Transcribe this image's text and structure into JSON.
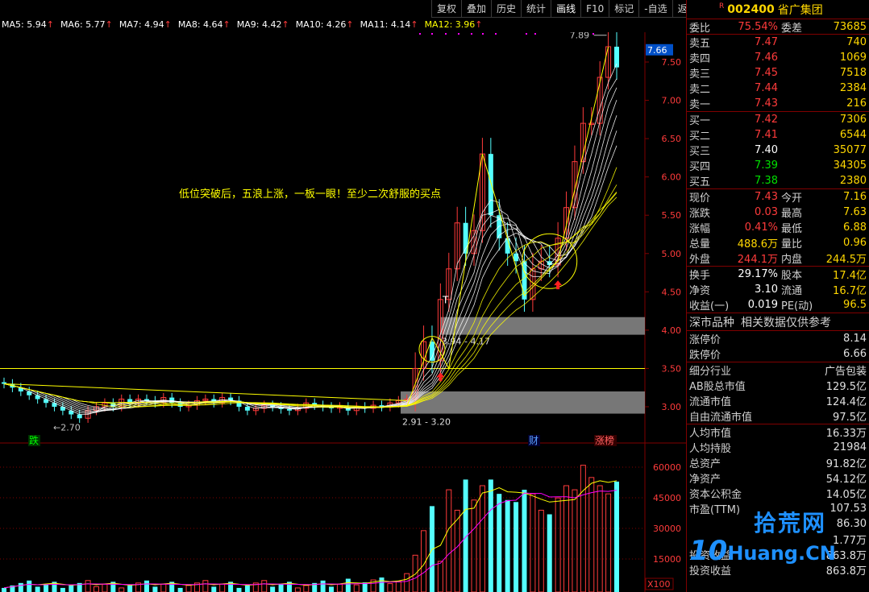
{
  "toolbar": [
    "复权",
    "叠加",
    "历史",
    "统计",
    "画线",
    "F10",
    "标记",
    "-自选",
    "返回"
  ],
  "toolbar_active": "画线",
  "ma_legend": [
    {
      "label": "MA5: 5.94",
      "color": "#ffffff"
    },
    {
      "label": "MA6: 5.77",
      "color": "#ffffff"
    },
    {
      "label": "MA7: 4.94",
      "color": "#ffffff"
    },
    {
      "label": "MA8: 4.64",
      "color": "#ffffff"
    },
    {
      "label": "MA9: 4.42",
      "color": "#ffffff"
    },
    {
      "label": "MA10: 4.26",
      "color": "#ffffff"
    },
    {
      "label": "MA11: 4.14",
      "color": "#ffffff"
    },
    {
      "label": "MA12: 3.96",
      "color": "#ffff00"
    }
  ],
  "ma_arrow": "↑",
  "chart": {
    "annotation": "低位突破后，五浪上涨，一板一眼！至少二次舒服的买点",
    "peak_label": "7.89",
    "current_price_label": "7.66",
    "low_label": "2.70",
    "zone_upper_label": "3.94 - 4.17",
    "zone_lower_label": "2.91 - 3.20",
    "t_marker": "T",
    "event_fall": "跌",
    "event_finance": "财",
    "event_list": "涨榜",
    "vol_unit": "X100",
    "price_ticks": [
      "7.50",
      "7.00",
      "6.50",
      "6.00",
      "5.50",
      "5.00",
      "4.50",
      "4.00",
      "3.50",
      "3.00"
    ],
    "vol_ticks": [
      "60000",
      "45000",
      "30000",
      "15000"
    ]
  },
  "chart_data": {
    "type": "candlestick",
    "price_axis": {
      "min": 2.6,
      "max": 8.0
    },
    "candles_early_note": "",
    "closes": [
      3.3,
      3.25,
      3.2,
      3.15,
      3.1,
      3.05,
      3.0,
      2.95,
      2.9,
      2.85,
      2.95,
      3.0,
      3.05,
      3.0,
      3.1,
      3.05,
      3.1,
      3.08,
      3.05,
      3.12,
      3.05,
      3.0,
      3.02,
      3.08,
      3.1,
      3.05,
      3.12,
      3.08,
      3.0,
      2.95,
      2.98,
      3.02,
      3.0,
      2.97,
      2.95,
      2.98,
      3.05,
      3.02,
      3.0,
      2.98,
      3.0,
      2.95,
      3.0,
      2.98,
      3.02,
      3.0,
      3.05,
      3.08,
      3.1,
      3.5,
      3.85,
      3.6,
      4.4,
      4.8,
      5.4,
      5.0,
      5.3,
      6.3,
      5.5,
      5.2,
      5.0,
      4.9,
      4.4,
      4.8,
      4.9,
      4.85,
      5.2,
      5.6,
      6.2,
      6.7,
      6.7,
      7.3,
      7.7,
      7.43
    ],
    "volumes_max": 65000
  },
  "quote": {
    "badge": "R",
    "code": "002400",
    "name": "省广集团",
    "weibi_label": "委比",
    "weibi": "75.54%",
    "weicha_label": "委差",
    "weicha": "73685",
    "sell": [
      {
        "label": "卖五",
        "price": "7.47",
        "vol": "740"
      },
      {
        "label": "卖四",
        "price": "7.46",
        "vol": "1069"
      },
      {
        "label": "卖三",
        "price": "7.45",
        "vol": "7518"
      },
      {
        "label": "卖二",
        "price": "7.44",
        "vol": "2384"
      },
      {
        "label": "卖一",
        "price": "7.43",
        "vol": "216"
      }
    ],
    "buy": [
      {
        "label": "买一",
        "price": "7.42",
        "vol": "7306",
        "cls": "red"
      },
      {
        "label": "买二",
        "price": "7.41",
        "vol": "6544",
        "cls": "red"
      },
      {
        "label": "买三",
        "price": "7.40",
        "vol": "35077",
        "cls": "white"
      },
      {
        "label": "买四",
        "price": "7.39",
        "vol": "34305",
        "cls": "green"
      },
      {
        "label": "买五",
        "price": "7.38",
        "vol": "2380",
        "cls": "green"
      }
    ],
    "stats": [
      {
        "l1": "现价",
        "v1": "7.43",
        "c1": "red",
        "l2": "今开",
        "v2": "7.16",
        "c2": "red"
      },
      {
        "l1": "涨跌",
        "v1": "0.03",
        "c1": "red",
        "l2": "最高",
        "v2": "7.63",
        "c2": "red"
      },
      {
        "l1": "涨幅",
        "v1": "0.41%",
        "c1": "red",
        "l2": "最低",
        "v2": "6.88",
        "c2": "green"
      },
      {
        "l1": "总量",
        "v1": "488.6万",
        "c1": "yellow",
        "l2": "量比",
        "v2": "0.96",
        "c2": "yellow"
      },
      {
        "l1": "外盘",
        "v1": "244.1万",
        "c1": "red",
        "l2": "内盘",
        "v2": "244.5万",
        "c2": "green"
      }
    ],
    "fund": [
      {
        "l1": "换手",
        "v1": "29.17%",
        "l2": "股本",
        "v2": "17.4亿"
      },
      {
        "l1": "净资",
        "v1": "3.10",
        "l2": "流通",
        "v2": "16.7亿"
      },
      {
        "l1": "收益(一)",
        "v1": "0.019",
        "l2": "PE(动)",
        "v2": "96.5"
      }
    ],
    "notice_left": "深市品种",
    "notice_right": "相关数据仅供参考",
    "limits": [
      {
        "label": "涨停价",
        "value": "8.14",
        "cls": "red"
      },
      {
        "label": "跌停价",
        "value": "6.66",
        "cls": "green"
      }
    ],
    "info": [
      {
        "label": "细分行业",
        "value": "广告包装",
        "cls": "yellow"
      },
      {
        "label": "AB股总市值",
        "value": "129.5亿",
        "cls": "white"
      },
      {
        "label": "流通市值",
        "value": "124.4亿",
        "cls": "white"
      },
      {
        "label": "自由流通市值",
        "value": "97.5亿",
        "cls": "white"
      }
    ],
    "info2": [
      {
        "label": "人均市值",
        "value": "16.33万"
      },
      {
        "label": "人均持股",
        "value": "21984"
      },
      {
        "label": "总资产",
        "value": "91.82亿"
      },
      {
        "label": "净资产",
        "value": "54.12亿"
      },
      {
        "label": "资本公积金",
        "value": "14.05亿"
      },
      {
        "label": "市盈(TTM)",
        "value": "107.53"
      },
      {
        "label": "",
        "value": "86.30"
      },
      {
        "label": "",
        "value": "1.77万"
      },
      {
        "label": "投资收益",
        "value": "863.8万"
      },
      {
        "label": "投资收益",
        "value": "863.8万"
      }
    ]
  },
  "watermark": {
    "top": "拾荒网",
    "bottom_big": "10",
    "bottom": "Huang.CN"
  }
}
